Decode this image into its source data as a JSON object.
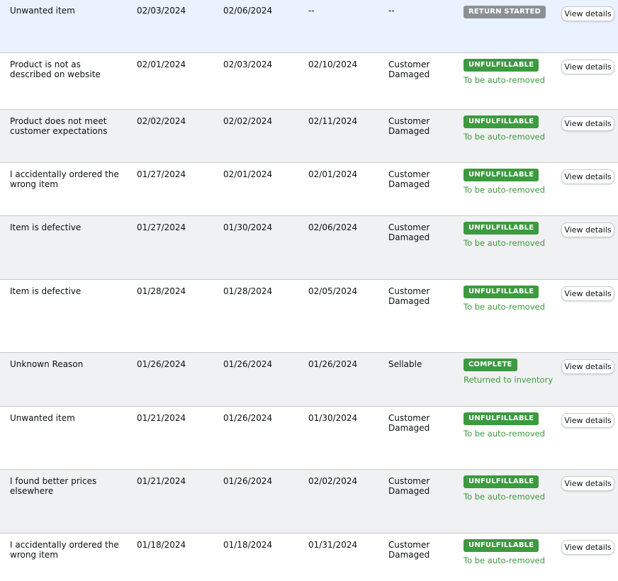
{
  "colors": {
    "return_started": "#8d9093",
    "unfulfillable": "#3c9a3f",
    "complete": "#3c9a3f",
    "sub_text": "#3c9a3f",
    "selected_row_bg": "#e9f2fe",
    "alt_row_bg": "#f0f1f2"
  },
  "view_details_label": "View details",
  "rows": [
    {
      "reason": "Unwanted item",
      "request_date": "02/03/2024",
      "return_date": "02/06/2024",
      "closed_date": "--",
      "disposition": "--",
      "status": "RETURN STARTED",
      "status_color": "#8d9093",
      "status_note": ""
    },
    {
      "reason": "Product is not as described on website",
      "request_date": "02/01/2024",
      "return_date": "02/03/2024",
      "closed_date": "02/10/2024",
      "disposition": "Customer Damaged",
      "status": "UNFULFILLABLE",
      "status_color": "#3c9a3f",
      "status_note": "To be auto-removed"
    },
    {
      "reason": "Product does not meet customer expectations",
      "request_date": "02/02/2024",
      "return_date": "02/02/2024",
      "closed_date": "02/11/2024",
      "disposition": "Customer Damaged",
      "status": "UNFULFILLABLE",
      "status_color": "#3c9a3f",
      "status_note": "To be auto-removed"
    },
    {
      "reason": "I accidentally ordered the wrong item",
      "request_date": "01/27/2024",
      "return_date": "02/01/2024",
      "closed_date": "02/01/2024",
      "disposition": "Customer Damaged",
      "status": "UNFULFILLABLE",
      "status_color": "#3c9a3f",
      "status_note": "To be auto-removed"
    },
    {
      "reason": "Item is defective",
      "request_date": "01/27/2024",
      "return_date": "01/30/2024",
      "closed_date": "02/06/2024",
      "disposition": "Customer Damaged",
      "status": "UNFULFILLABLE",
      "status_color": "#3c9a3f",
      "status_note": "To be auto-removed"
    },
    {
      "reason": "Item is defective",
      "request_date": "01/28/2024",
      "return_date": "01/28/2024",
      "closed_date": "02/05/2024",
      "disposition": "Customer Damaged",
      "status": "UNFULFILLABLE",
      "status_color": "#3c9a3f",
      "status_note": "To be auto-removed"
    },
    {
      "reason": "Unknown Reason",
      "request_date": "01/26/2024",
      "return_date": "01/26/2024",
      "closed_date": "01/26/2024",
      "disposition": "Sellable",
      "status": "COMPLETE",
      "status_color": "#3c9a3f",
      "status_note": "Returned to inventory"
    },
    {
      "reason": "Unwanted item",
      "request_date": "01/21/2024",
      "return_date": "01/26/2024",
      "closed_date": "01/30/2024",
      "disposition": "Customer Damaged",
      "status": "UNFULFILLABLE",
      "status_color": "#3c9a3f",
      "status_note": "To be auto-removed"
    },
    {
      "reason": "I found better prices elsewhere",
      "request_date": "01/21/2024",
      "return_date": "01/26/2024",
      "closed_date": "02/02/2024",
      "disposition": "Customer Damaged",
      "status": "UNFULFILLABLE",
      "status_color": "#3c9a3f",
      "status_note": "To be auto-removed"
    },
    {
      "reason": "I accidentally ordered the wrong item",
      "request_date": "01/18/2024",
      "return_date": "01/18/2024",
      "closed_date": "01/31/2024",
      "disposition": "Customer Damaged",
      "status": "UNFULFILLABLE",
      "status_color": "#3c9a3f",
      "status_note": "To be auto-removed"
    }
  ]
}
